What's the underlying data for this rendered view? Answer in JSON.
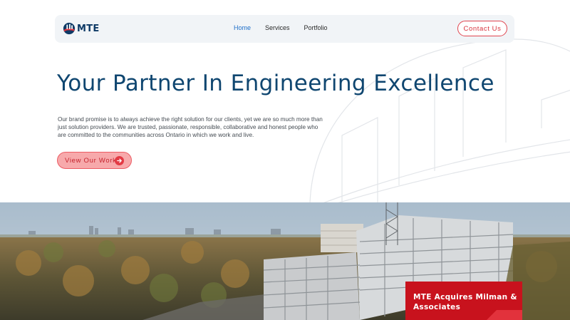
{
  "brand": {
    "logo_text": "MTE",
    "accent_color": "#c8121d",
    "primary_color": "#0f4670"
  },
  "header": {
    "nav": [
      {
        "label": "Home",
        "active": true
      },
      {
        "label": "Services",
        "active": false
      },
      {
        "label": "Portfolio",
        "active": false
      }
    ],
    "contact_label": "Contact Us"
  },
  "hero": {
    "title": "Your Partner In Engineering Excellence",
    "body": "Our brand promise is to always achieve the right solution for our clients, yet we are so much more than just solution providers. We are trusted, passionate, responsible, collaborative and honest people who are committed to the communities across Ontario in which we work and live.",
    "cta_label": "View Our Work",
    "cta_icon": "arrow-right-icon"
  },
  "news": {
    "title": "MTE Acquires Milman & Associates"
  }
}
